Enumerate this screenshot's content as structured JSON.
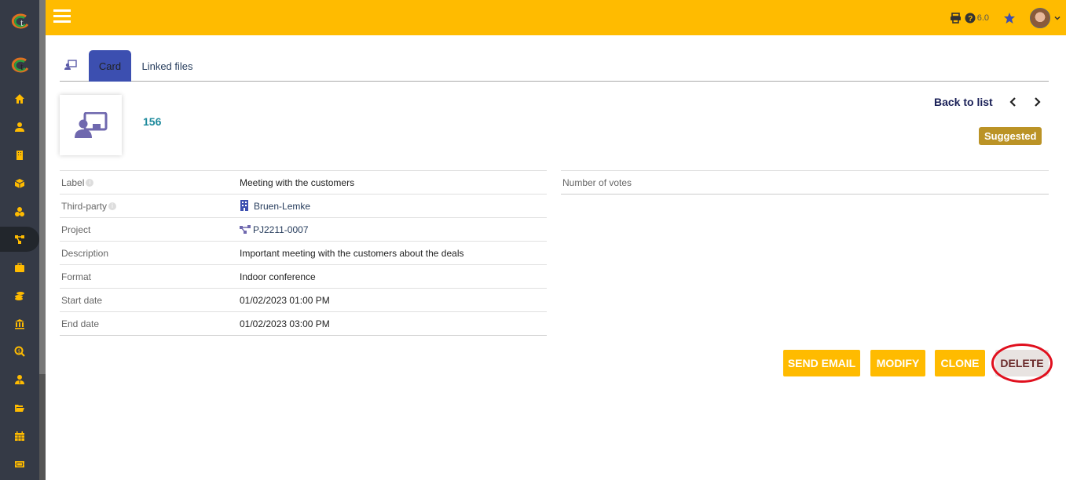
{
  "topbar": {
    "version": "6.0",
    "icons": [
      "menu-icon",
      "print-icon",
      "help-icon",
      "star-icon",
      "avatar",
      "chevron-down-icon"
    ]
  },
  "sidebar": {
    "items": [
      {
        "icon": "home-icon"
      },
      {
        "icon": "user-icon"
      },
      {
        "icon": "building-icon"
      },
      {
        "icon": "box-icon"
      },
      {
        "icon": "cubes-icon"
      },
      {
        "icon": "project-tree-icon",
        "active": true
      },
      {
        "icon": "briefcase-icon"
      },
      {
        "icon": "coins-icon"
      },
      {
        "icon": "bank-icon"
      },
      {
        "icon": "search-dollar-icon"
      },
      {
        "icon": "user-tie-icon"
      },
      {
        "icon": "folder-open-icon"
      },
      {
        "icon": "calendar-icon"
      },
      {
        "icon": "ticket-icon"
      }
    ]
  },
  "tabs": [
    {
      "label": "Card",
      "active": true
    },
    {
      "label": "Linked files",
      "active": false
    }
  ],
  "header": {
    "ref": "156",
    "back_to_list": "Back to list",
    "prev": "‹",
    "next": "›",
    "status_badge": "Suggested"
  },
  "fields": [
    {
      "label": "Label",
      "value": "Meeting with the customers",
      "info": true
    },
    {
      "label": "Third-party",
      "value": "Bruen-Lemke",
      "info": true,
      "link": true
    },
    {
      "label": "Project",
      "value": "PJ2211-0007",
      "link": true
    },
    {
      "label": "Description",
      "value": "Important meeting with the customers about the deals"
    },
    {
      "label": "Format",
      "value": "Indoor conference"
    },
    {
      "label": "Start date",
      "value": "01/02/2023 01:00 PM"
    },
    {
      "label": "End date",
      "value": "01/02/2023 03:00 PM"
    }
  ],
  "right_fields": [
    {
      "label": "Number of votes",
      "value": ""
    }
  ],
  "actions": {
    "send_email": "SEND EMAIL",
    "modify": "MODIFY",
    "clone": "CLONE",
    "delete": "DELETE"
  },
  "colors": {
    "topbar": "#ffbb00",
    "sidebar": "#353a46",
    "tab_active": "#3c4fb0",
    "badge": "#bb9326",
    "highlight_circle": "#e0101e"
  }
}
